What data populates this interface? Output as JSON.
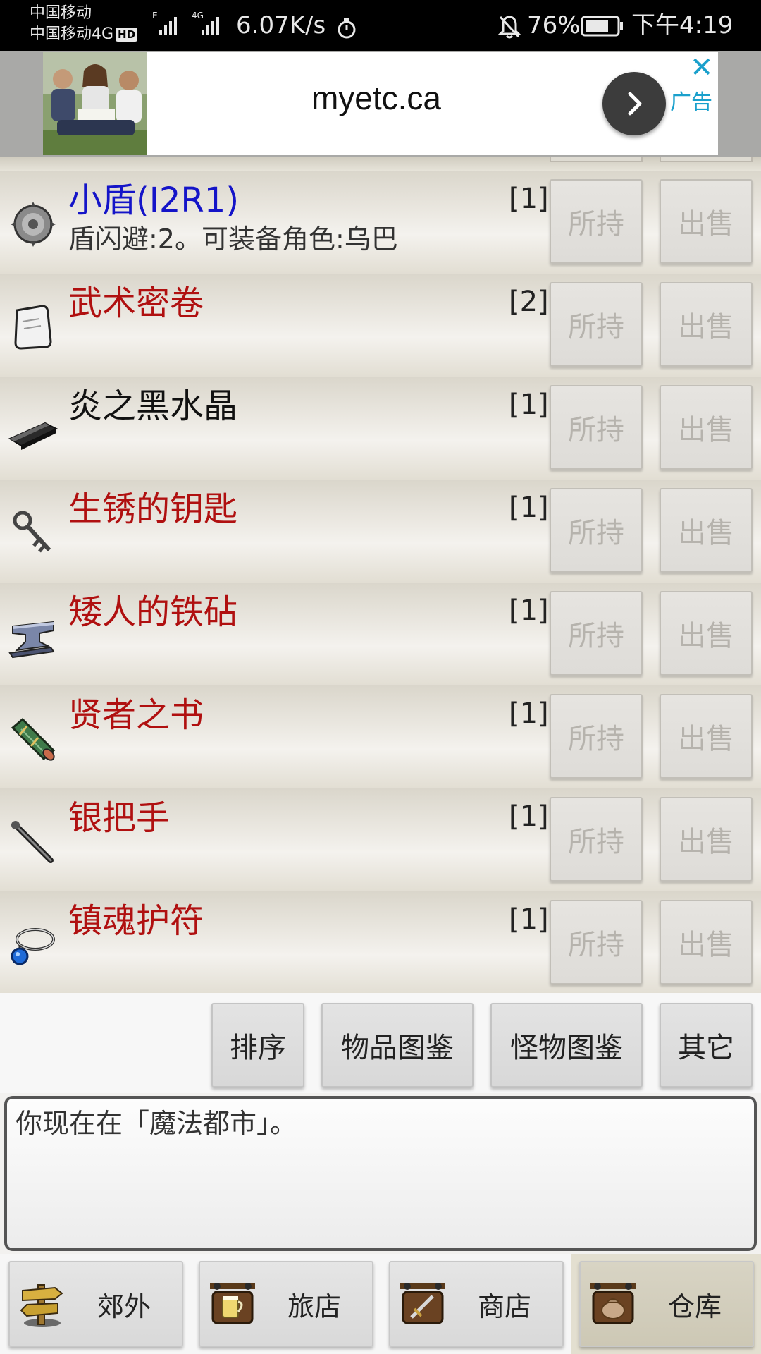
{
  "status_bar": {
    "carrier_1": "中国移动",
    "carrier_2": "中国移动4G",
    "hd_badge": "HD",
    "net_speed": "6.07K/s",
    "battery_percent": "76%",
    "time": "下午4:19"
  },
  "ad": {
    "url": "myetc.ca",
    "close_label": "✕",
    "ad_label": "广告"
  },
  "items": [
    {
      "name": "小盾(I2R1)",
      "desc": "盾闪避:2。可装备角色:乌巴",
      "count": "[1]",
      "hold": "所持",
      "sell": "出售",
      "name_color": "#1414c8",
      "icon": "shield-icon"
    },
    {
      "name": "武术密卷",
      "desc": "",
      "count": "[2]",
      "hold": "所持",
      "sell": "出售",
      "name_color": "#b01010",
      "icon": "scroll-icon"
    },
    {
      "name": "炎之黑水晶",
      "desc": "",
      "count": "[1]",
      "hold": "所持",
      "sell": "出售",
      "name_color": "#111111",
      "icon": "black-crystal-icon"
    },
    {
      "name": "生锈的钥匙",
      "desc": "",
      "count": "[1]",
      "hold": "所持",
      "sell": "出售",
      "name_color": "#b01010",
      "icon": "key-icon"
    },
    {
      "name": "矮人的铁砧",
      "desc": "",
      "count": "[1]",
      "hold": "所持",
      "sell": "出售",
      "name_color": "#b01010",
      "icon": "anvil-icon"
    },
    {
      "name": "贤者之书",
      "desc": "",
      "count": "[1]",
      "hold": "所持",
      "sell": "出售",
      "name_color": "#b01010",
      "icon": "book-scroll-icon"
    },
    {
      "name": "银把手",
      "desc": "",
      "count": "[1]",
      "hold": "所持",
      "sell": "出售",
      "name_color": "#b01010",
      "icon": "handle-icon"
    },
    {
      "name": "镇魂护符",
      "desc": "",
      "count": "[1]",
      "hold": "所持",
      "sell": "出售",
      "name_color": "#b01010",
      "icon": "amulet-icon"
    }
  ],
  "toolbar": {
    "sort": "排序",
    "item_book": "物品图鉴",
    "monster_book": "怪物图鉴",
    "other": "其它"
  },
  "message": "你现在在「魔法都市」。",
  "nav": [
    {
      "label": "郊外",
      "icon": "signpost-icon"
    },
    {
      "label": "旅店",
      "icon": "inn-sign-icon"
    },
    {
      "label": "商店",
      "icon": "shop-sign-icon"
    },
    {
      "label": "仓库",
      "icon": "warehouse-sign-icon"
    }
  ]
}
